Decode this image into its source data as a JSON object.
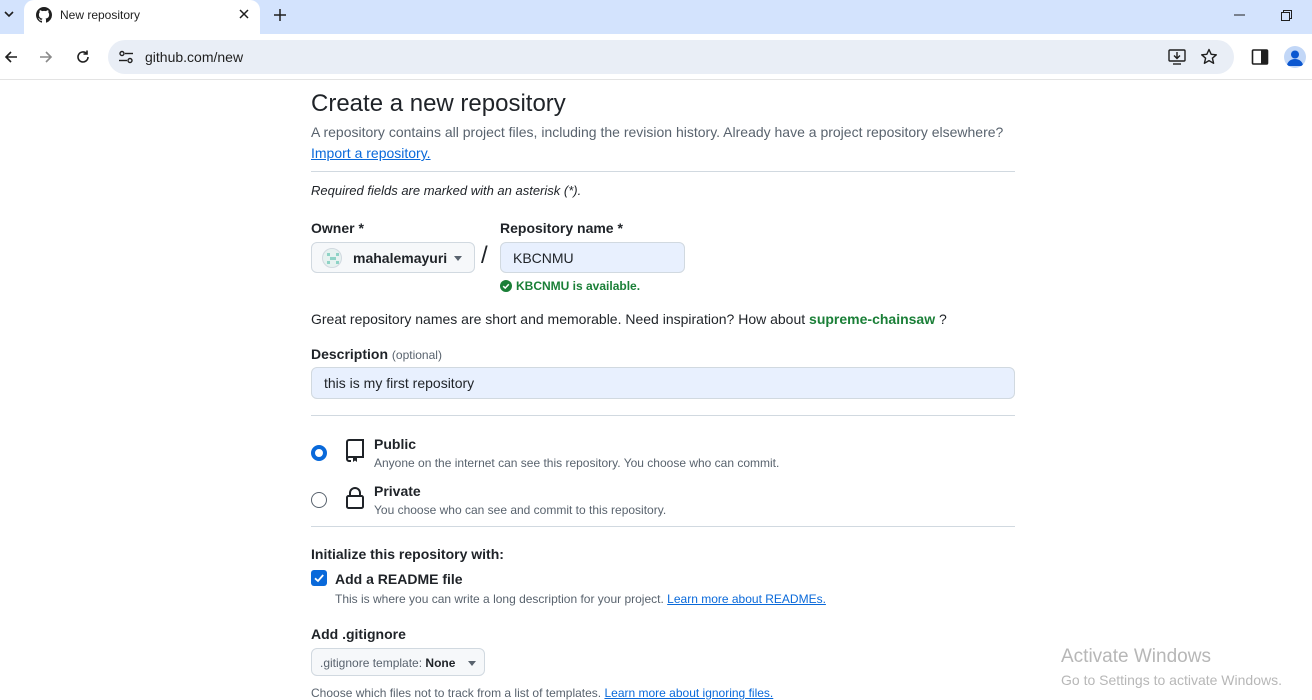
{
  "browser": {
    "tab_title": "New repository",
    "url": "github.com/new"
  },
  "page": {
    "title": "Create a new repository",
    "subtitle": "A repository contains all project files, including the revision history. Already have a project repository elsewhere?",
    "import_link": "Import a repository.",
    "required_note": "Required fields are marked with an asterisk (*)."
  },
  "form": {
    "owner_label": "Owner *",
    "owner_value": "mahalemayuri",
    "repo_label": "Repository name *",
    "repo_value": "KBCNMU",
    "availability": "KBCNMU is available.",
    "inspiration_text": "Great repository names are short and memorable. Need inspiration? How about",
    "inspiration_suggestion": "supreme-chainsaw",
    "inspiration_end": "?",
    "description_label": "Description",
    "description_optional": "(optional)",
    "description_value": "this is my first repository"
  },
  "visibility": {
    "public_title": "Public",
    "public_desc": "Anyone on the internet can see this repository. You choose who can commit.",
    "private_title": "Private",
    "private_desc": "You choose who can see and commit to this repository.",
    "selected": "public"
  },
  "init": {
    "label": "Initialize this repository with:",
    "readme_title": "Add a README file",
    "readme_desc": "This is where you can write a long description for your project.",
    "readme_link": "Learn more about READMEs.",
    "readme_checked": true,
    "gitignore_label": "Add .gitignore",
    "gitignore_prefix": ".gitignore template:",
    "gitignore_value": "None",
    "gitignore_desc": "Choose which files not to track from a list of templates.",
    "gitignore_link": "Learn more about ignoring files."
  },
  "watermark": {
    "line1": "Activate Windows",
    "line2": "Go to Settings to activate Windows."
  },
  "colors": {
    "accent": "#0969da",
    "success": "#1a7f37",
    "tabbar": "#d3e3fd"
  }
}
